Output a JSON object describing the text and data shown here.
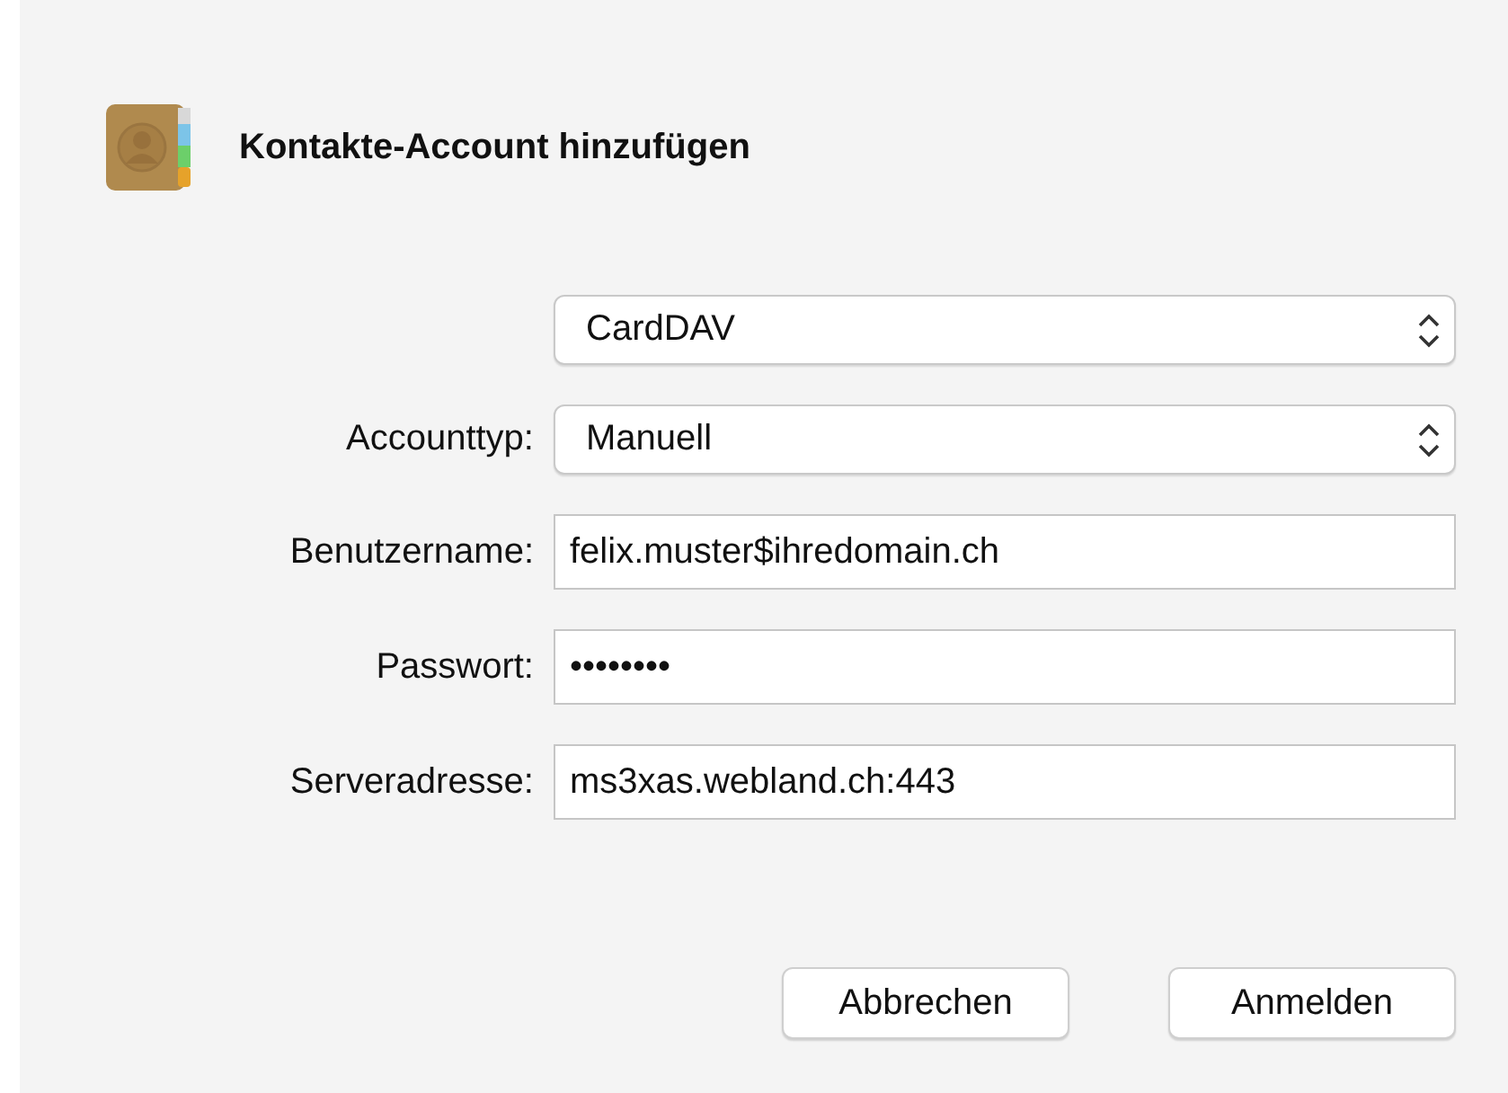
{
  "dialog": {
    "title": "Kontakte-Account hinzufügen"
  },
  "fields": [
    {
      "kind": "popup",
      "value": "CardDAV"
    },
    {
      "kind": "popup",
      "label": "Accounttyp:",
      "value": "Manuell"
    },
    {
      "kind": "text",
      "label": "Benutzername:",
      "value": "felix.muster$ihredomain.ch"
    },
    {
      "kind": "text",
      "label": "Passwort:",
      "value": "••••••••"
    },
    {
      "kind": "text",
      "label": "Serveradresse:",
      "value": "ms3xas.webland.ch:443"
    }
  ],
  "buttons": [
    "Abbrechen",
    "Anmelden"
  ]
}
